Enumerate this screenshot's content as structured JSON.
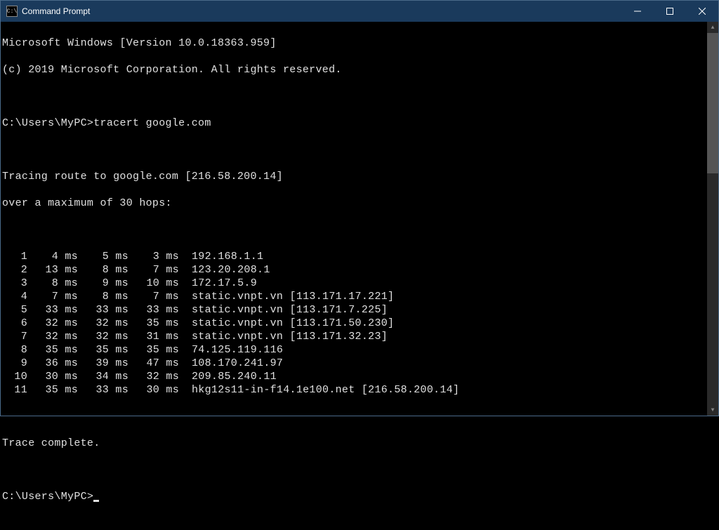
{
  "titlebar": {
    "title": "Command Prompt",
    "icon_label": "C:\\"
  },
  "header": {
    "line1": "Microsoft Windows [Version 10.0.18363.959]",
    "line2": "(c) 2019 Microsoft Corporation. All rights reserved."
  },
  "prompt1": {
    "path": "C:\\Users\\MyPC>",
    "command": "tracert google.com"
  },
  "trace_header": {
    "line1": "Tracing route to google.com [216.58.200.14]",
    "line2": "over a maximum of 30 hops:"
  },
  "hops": [
    {
      "n": "1",
      "t1": "4 ms",
      "t2": "5 ms",
      "t3": "3 ms",
      "host": "192.168.1.1"
    },
    {
      "n": "2",
      "t1": "13 ms",
      "t2": "8 ms",
      "t3": "7 ms",
      "host": "123.20.208.1"
    },
    {
      "n": "3",
      "t1": "8 ms",
      "t2": "9 ms",
      "t3": "10 ms",
      "host": "172.17.5.9"
    },
    {
      "n": "4",
      "t1": "7 ms",
      "t2": "8 ms",
      "t3": "7 ms",
      "host": "static.vnpt.vn [113.171.17.221]"
    },
    {
      "n": "5",
      "t1": "33 ms",
      "t2": "33 ms",
      "t3": "33 ms",
      "host": "static.vnpt.vn [113.171.7.225]"
    },
    {
      "n": "6",
      "t1": "32 ms",
      "t2": "32 ms",
      "t3": "35 ms",
      "host": "static.vnpt.vn [113.171.50.230]"
    },
    {
      "n": "7",
      "t1": "32 ms",
      "t2": "32 ms",
      "t3": "31 ms",
      "host": "static.vnpt.vn [113.171.32.23]"
    },
    {
      "n": "8",
      "t1": "35 ms",
      "t2": "35 ms",
      "t3": "35 ms",
      "host": "74.125.119.116"
    },
    {
      "n": "9",
      "t1": "36 ms",
      "t2": "39 ms",
      "t3": "47 ms",
      "host": "108.170.241.97"
    },
    {
      "n": "10",
      "t1": "30 ms",
      "t2": "34 ms",
      "t3": "32 ms",
      "host": "209.85.240.11"
    },
    {
      "n": "11",
      "t1": "35 ms",
      "t2": "33 ms",
      "t3": "30 ms",
      "host": "hkg12s11-in-f14.1e100.net [216.58.200.14]"
    }
  ],
  "trace_footer": "Trace complete.",
  "prompt2": {
    "path": "C:\\Users\\MyPC>"
  }
}
